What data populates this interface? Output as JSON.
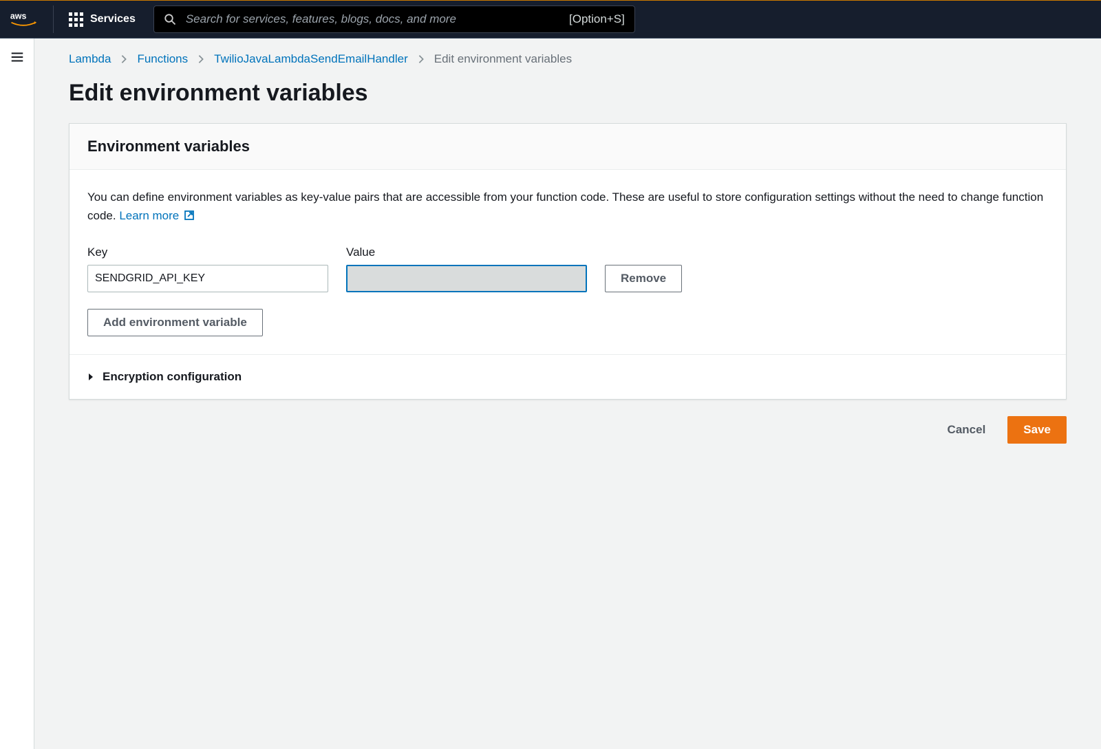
{
  "nav": {
    "services_label": "Services",
    "search_placeholder": "Search for services, features, blogs, docs, and more",
    "search_shortcut": "[Option+S]"
  },
  "breadcrumbs": {
    "items": [
      {
        "label": "Lambda"
      },
      {
        "label": "Functions"
      },
      {
        "label": "TwilioJavaLambdaSendEmailHandler"
      }
    ],
    "current": "Edit environment variables"
  },
  "page": {
    "title": "Edit environment variables"
  },
  "panel": {
    "header": "Environment variables",
    "description_part1": "You can define environment variables as key-value pairs that are accessible from your function code. These are useful to store configuration settings without the need to change function code. ",
    "learn_more": "Learn more",
    "key_label": "Key",
    "value_label": "Value",
    "rows": [
      {
        "key": "SENDGRID_API_KEY",
        "value": ""
      }
    ],
    "remove_label": "Remove",
    "add_label": "Add environment variable",
    "encryption_label": "Encryption configuration"
  },
  "actions": {
    "cancel": "Cancel",
    "save": "Save"
  }
}
